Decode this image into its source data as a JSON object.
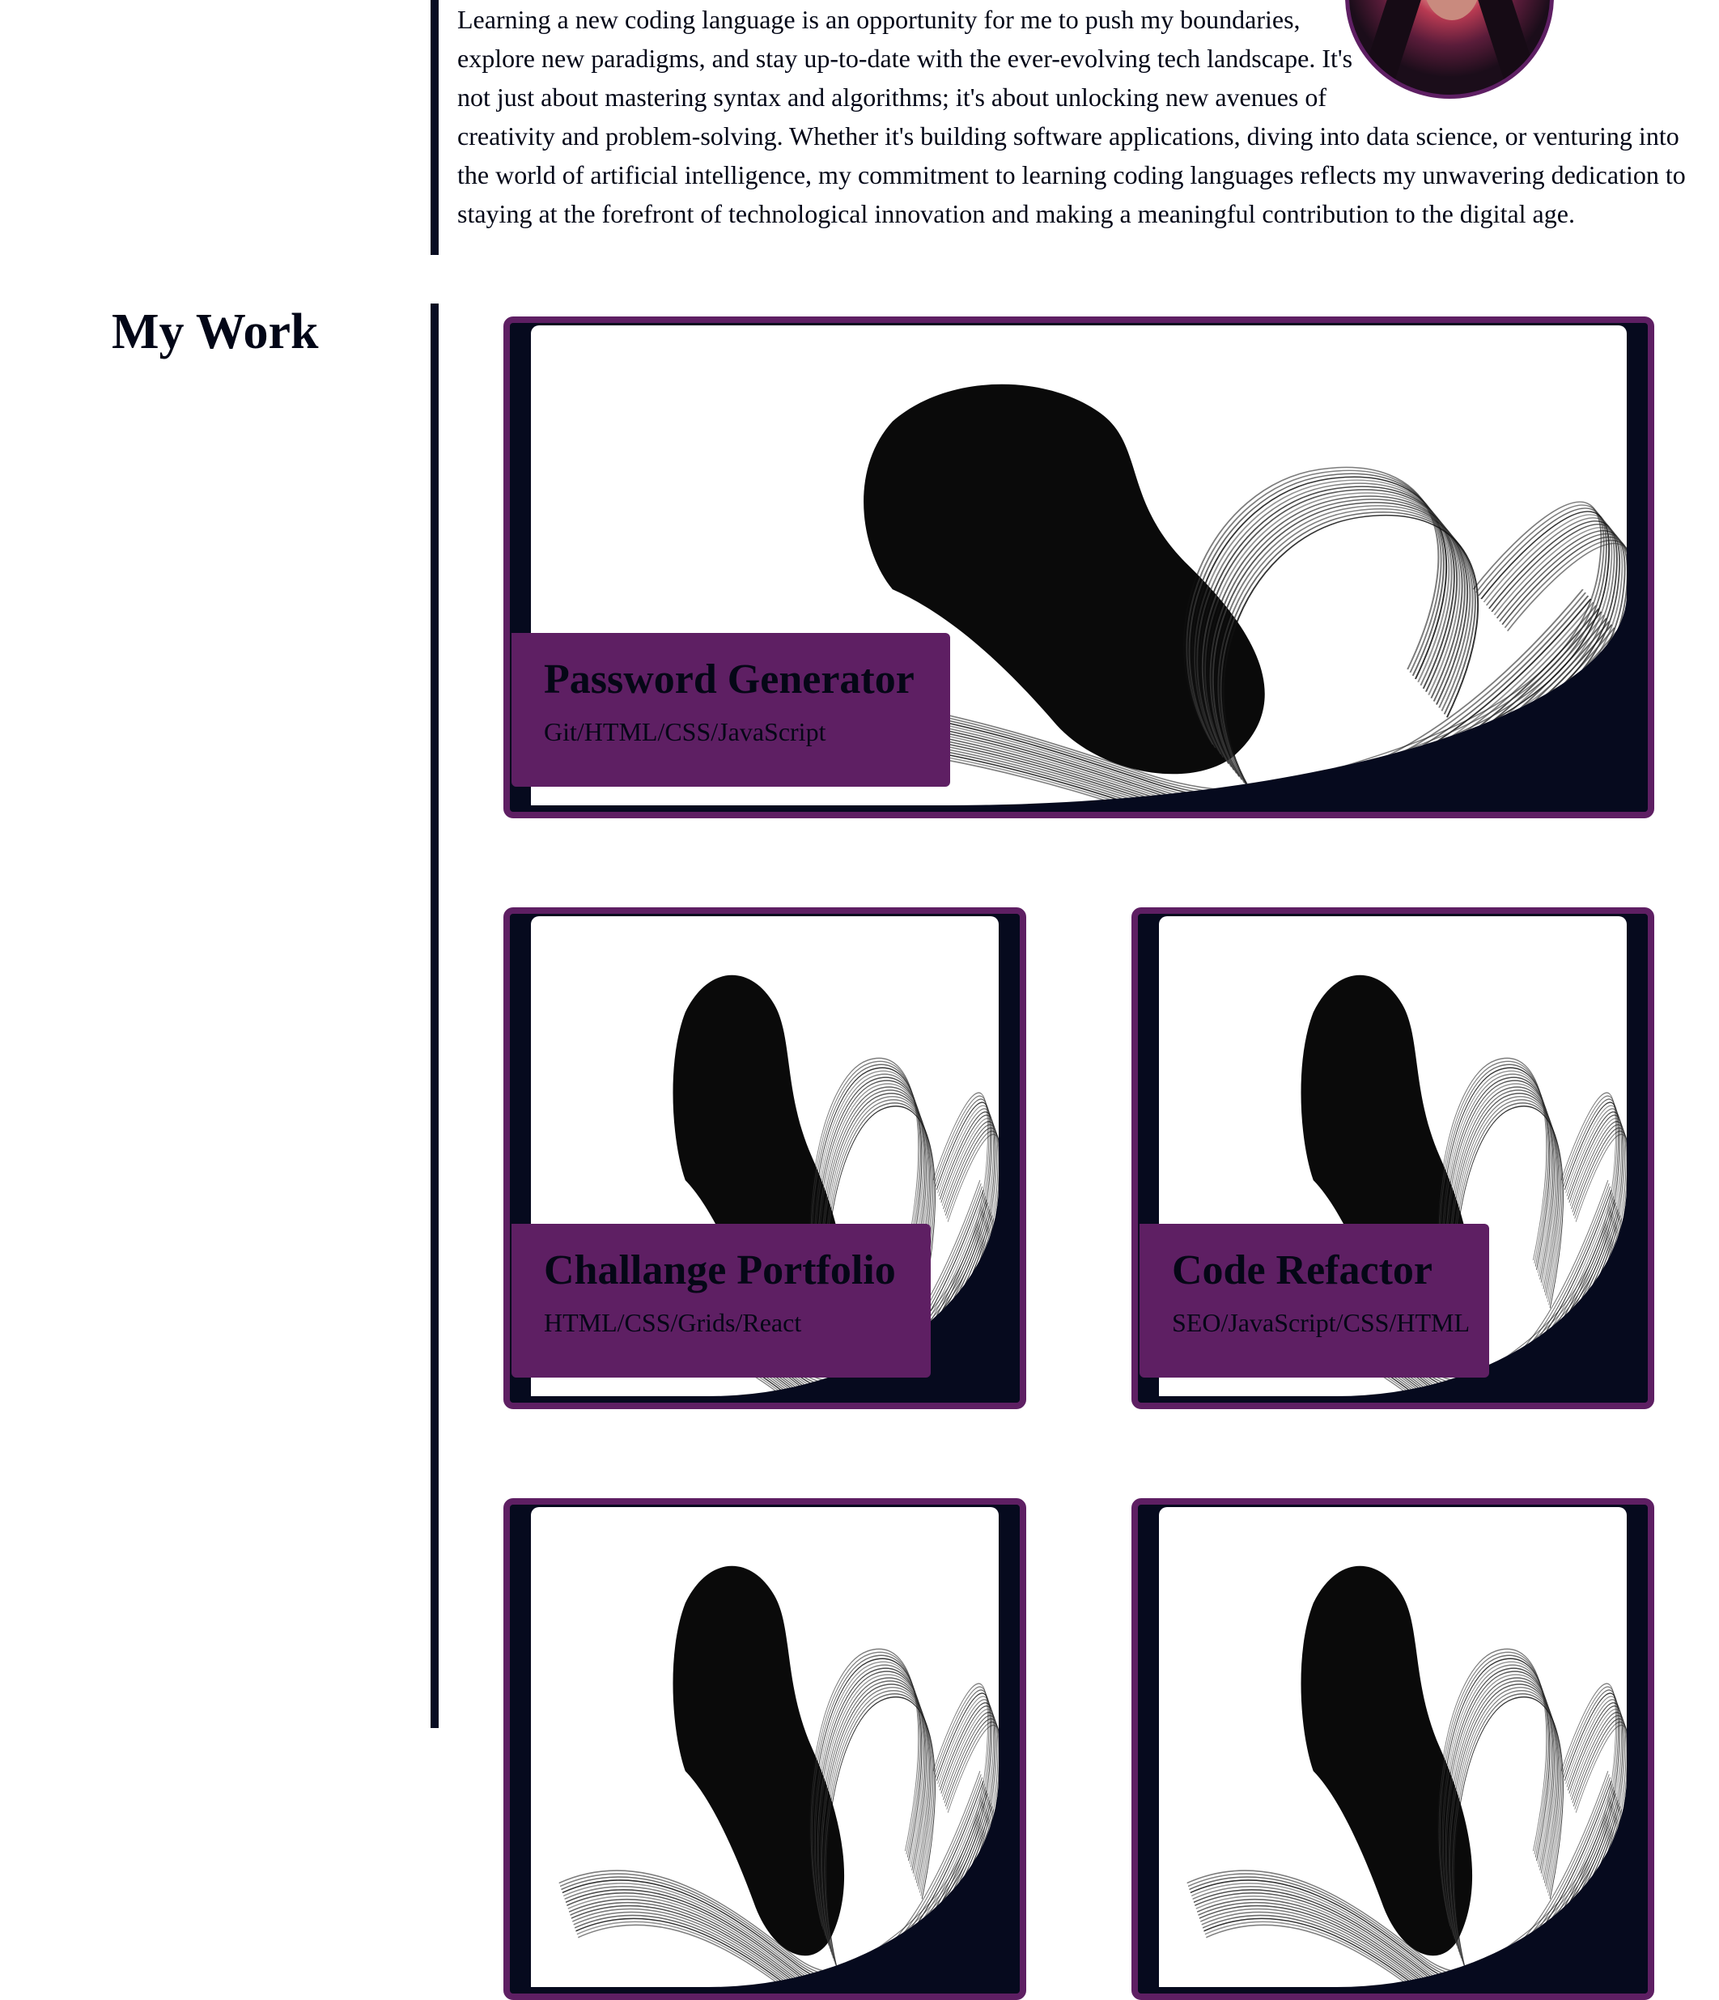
{
  "about": {
    "paragraph": "Learning a new coding language is an opportunity for me to push my boundaries, explore new paradigms, and stay up-to-date with the ever-evolving tech landscape. It's not just about mastering syntax and algorithms; it's about unlocking new avenues of creativity and problem-solving. Whether it's building software applications, diving into data science, or venturing into the world of artificial intelligence, my commitment to learning coding languages reflects my unwavering dedication to staying at the forefront of technological innovation and making a meaningful contribution to the digital age."
  },
  "work": {
    "heading": "My Work",
    "projects": [
      {
        "title": "Password Generator",
        "tags": "Git/HTML/CSS/JavaScript"
      },
      {
        "title": "Challange Portfolio",
        "tags": "HTML/CSS/Grids/React"
      },
      {
        "title": "Code Refactor",
        "tags": "SEO/JavaScript/CSS/HTML"
      },
      {
        "title": "",
        "tags": ""
      },
      {
        "title": "",
        "tags": ""
      }
    ]
  },
  "colors": {
    "accent": "#5e1f63",
    "dark": "#060a1e",
    "divider": "#080c22"
  },
  "icons": {
    "project-art": "ink-brush-stroke-image",
    "profile": "profile-photo"
  }
}
